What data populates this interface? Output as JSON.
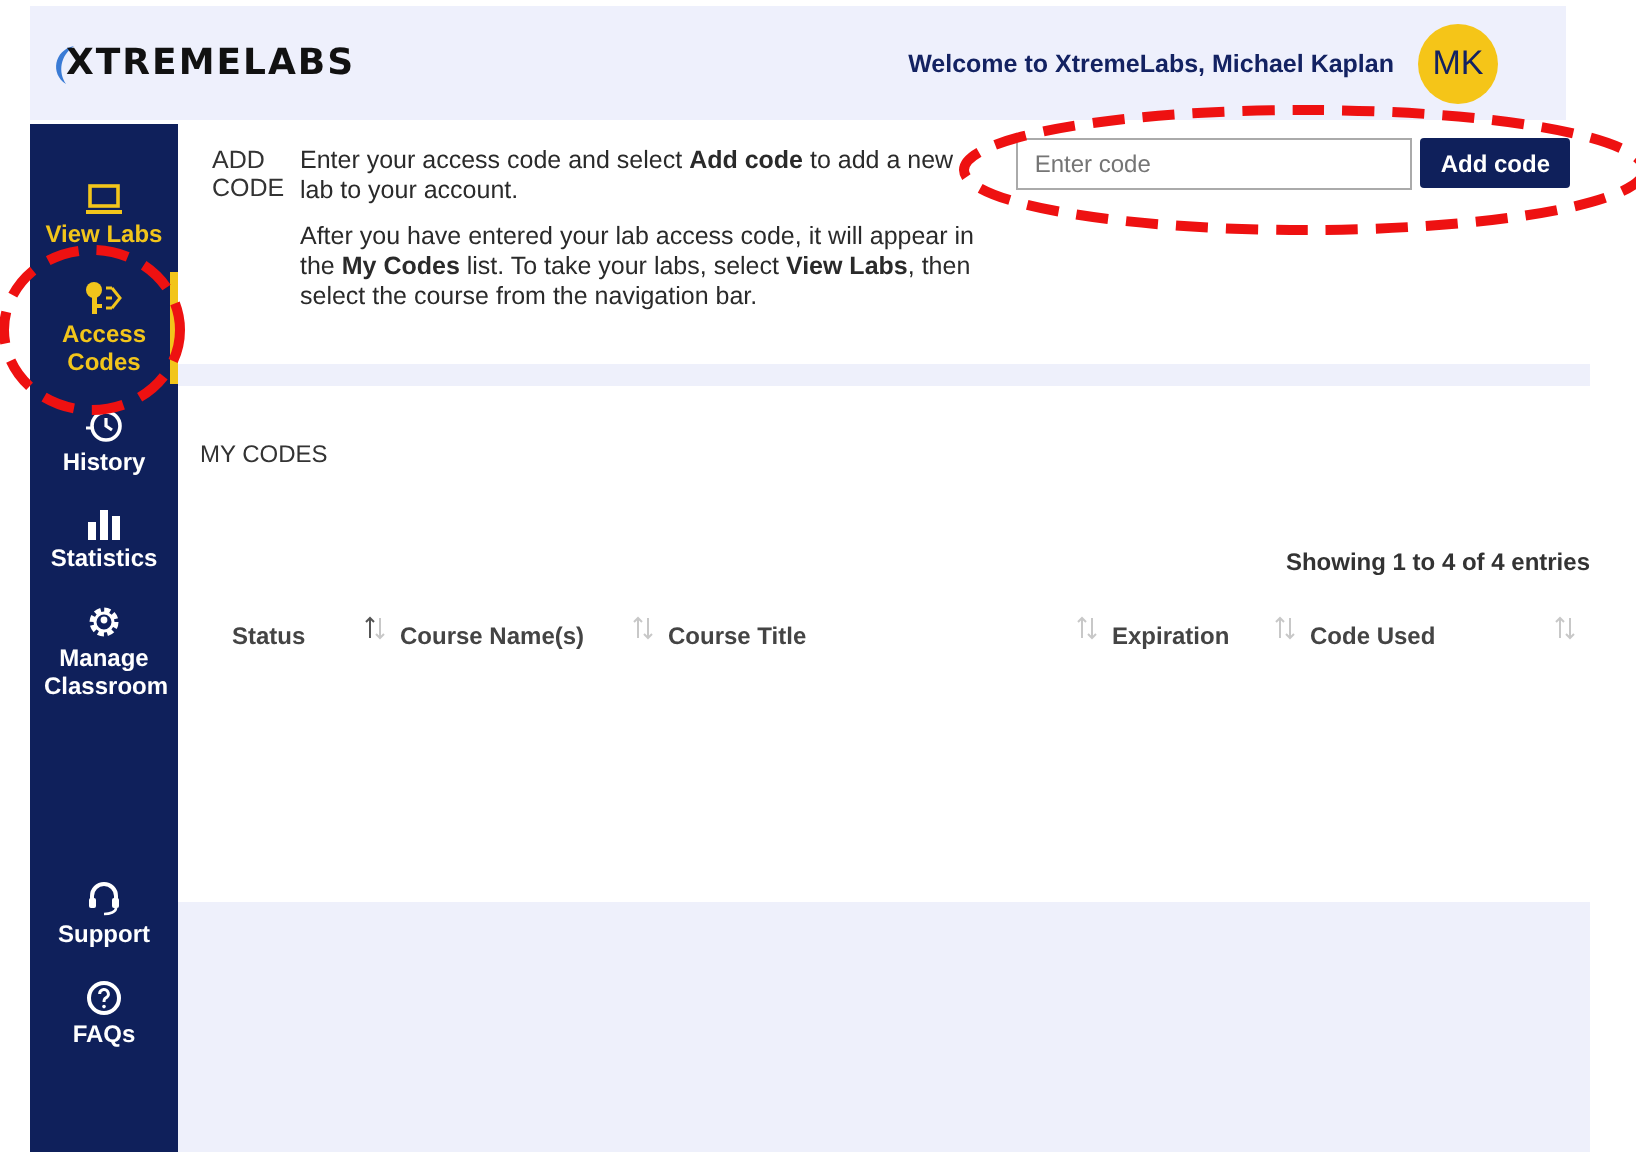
{
  "header": {
    "logo": "XTREMELABS",
    "welcome": "Welcome to XtremeLabs, Michael Kaplan",
    "avatar": "MK"
  },
  "sidebar": {
    "items": [
      {
        "kind": "monitor",
        "label": "View Labs",
        "selected": false,
        "highlighted": true
      },
      {
        "kind": "key",
        "label": "Access Codes",
        "selected": true,
        "highlighted": true
      },
      {
        "kind": "history",
        "label": "History",
        "selected": false,
        "highlighted": false
      },
      {
        "kind": "chart",
        "label": "Statistics",
        "selected": false,
        "highlighted": false
      },
      {
        "kind": "gear",
        "label": "Manage Classroom",
        "selected": false,
        "highlighted": false
      }
    ],
    "bottom_items": [
      {
        "kind": "headset",
        "label": "Support",
        "selected": false,
        "highlighted": false
      },
      {
        "kind": "question",
        "label": "FAQs",
        "selected": false,
        "highlighted": false
      }
    ]
  },
  "add_code": {
    "label": "ADD CODE",
    "intro": "Enter your access code and select **Add code** to add a new lab to your account.",
    "note": "After you have entered your lab access code, it will appear in the **My Codes** list. To take your labs, select **View Labs**, then select the course from the navigation bar.",
    "placeholder": "Enter code",
    "button": "Add code"
  },
  "my_codes": {
    "title": "MY CODES",
    "info": "Showing 1 to 4 of 4 entries",
    "columns": [
      {
        "label": "Status",
        "sorted": true
      },
      {
        "label": "Course Name(s)",
        "sorted": false
      },
      {
        "label": "Course Title",
        "sorted": false
      },
      {
        "label": "Expiration",
        "sorted": false
      },
      {
        "label": "Code Used",
        "sorted": false
      }
    ]
  },
  "annotations": [
    {
      "kind": "ellipse"
    },
    {
      "kind": "ellipse"
    }
  ]
}
